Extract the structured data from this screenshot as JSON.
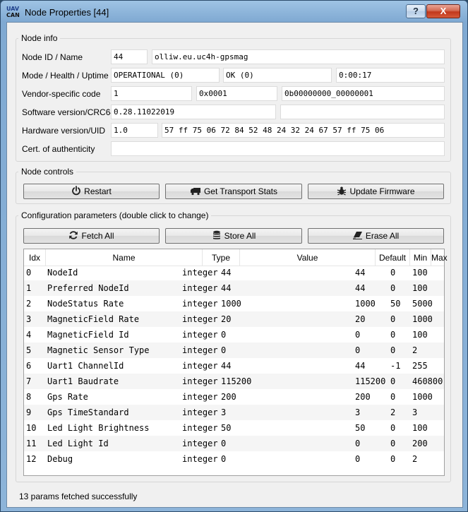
{
  "window": {
    "title": "Node Properties [44]",
    "icon_text_line1": "UAV",
    "icon_text_line2": "CAN",
    "help_label": "?",
    "close_label": "X"
  },
  "node_info": {
    "group_title": "Node info",
    "labels": {
      "id_name": "Node ID / Name",
      "mode": "Mode / Health / Uptime",
      "vendor": "Vendor-specific code",
      "software": "Software version/CRC64",
      "hardware": "Hardware version/UID",
      "cert": "Cert. of authenticity"
    },
    "node_id": "44",
    "node_name": "olliw.eu.uc4h-gpsmag",
    "mode": "OPERATIONAL (0)",
    "health": "OK (0)",
    "uptime": "0:00:17",
    "vendor_1": "1",
    "vendor_2": "0x0001",
    "vendor_3": "0b00000000_00000001",
    "software_version": "0.28.11022019",
    "software_crc": "",
    "hardware_version": "1.0",
    "hardware_uid": "57 ff 75 06 72 84 52 48 24 32 24 67 57 ff 75 06",
    "cert": ""
  },
  "node_controls": {
    "group_title": "Node controls",
    "restart_label": "Restart",
    "transport_label": "Get Transport Stats",
    "firmware_label": "Update Firmware"
  },
  "config": {
    "group_title": "Configuration parameters (double click to change)",
    "fetch_label": "Fetch All",
    "store_label": "Store All",
    "erase_label": "Erase All",
    "columns": [
      "Idx",
      "Name",
      "Type",
      "Value",
      "Default",
      "Min",
      "Max"
    ],
    "rows": [
      {
        "idx": "0",
        "name": "NodeId",
        "type": "integer",
        "value": "44",
        "default": "44",
        "min": "0",
        "max": "100"
      },
      {
        "idx": "1",
        "name": "Preferred NodeId",
        "type": "integer",
        "value": "44",
        "default": "44",
        "min": "0",
        "max": "100"
      },
      {
        "idx": "2",
        "name": "NodeStatus Rate",
        "type": "integer",
        "value": "1000",
        "default": "1000",
        "min": "50",
        "max": "5000"
      },
      {
        "idx": "3",
        "name": "MagneticField Rate",
        "type": "integer",
        "value": "20",
        "default": "20",
        "min": "0",
        "max": "1000"
      },
      {
        "idx": "4",
        "name": "MagneticField Id",
        "type": "integer",
        "value": "0",
        "default": "0",
        "min": "0",
        "max": "100"
      },
      {
        "idx": "5",
        "name": "Magnetic Sensor Type",
        "type": "integer",
        "value": "0",
        "default": "0",
        "min": "0",
        "max": "2"
      },
      {
        "idx": "6",
        "name": "Uart1 ChannelId",
        "type": "integer",
        "value": "44",
        "default": "44",
        "min": "-1",
        "max": "255"
      },
      {
        "idx": "7",
        "name": "Uart1 Baudrate",
        "type": "integer",
        "value": "115200",
        "default": "115200",
        "min": "0",
        "max": "460800"
      },
      {
        "idx": "8",
        "name": "Gps Rate",
        "type": "integer",
        "value": "200",
        "default": "200",
        "min": "0",
        "max": "1000"
      },
      {
        "idx": "9",
        "name": "Gps TimeStandard",
        "type": "integer",
        "value": "3",
        "default": "3",
        "min": "2",
        "max": "3"
      },
      {
        "idx": "10",
        "name": "Led Light Brightness",
        "type": "integer",
        "value": "50",
        "default": "50",
        "min": "0",
        "max": "100"
      },
      {
        "idx": "11",
        "name": "Led Light Id",
        "type": "integer",
        "value": "0",
        "default": "0",
        "min": "0",
        "max": "200"
      },
      {
        "idx": "12",
        "name": "Debug",
        "type": "integer",
        "value": "0",
        "default": "0",
        "min": "0",
        "max": "2"
      }
    ]
  },
  "status": {
    "message": "13 params fetched successfully"
  }
}
